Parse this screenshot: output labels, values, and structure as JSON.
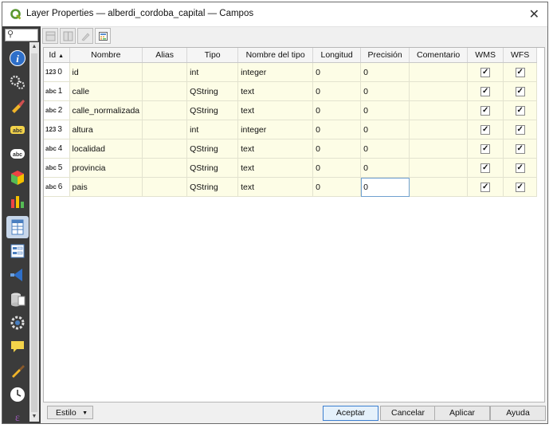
{
  "window": {
    "title": "Layer Properties — alberdi_cordoba_capital — Campos",
    "close_glyph": "✕"
  },
  "sidebar": {
    "search_placeholder": "",
    "items": [
      {
        "icon": "information-icon"
      },
      {
        "icon": "source-gears-icon"
      },
      {
        "icon": "symbology-brush-icon"
      },
      {
        "icon": "labels-icon"
      },
      {
        "icon": "mask-labels-icon"
      },
      {
        "icon": "3d-view-icon"
      },
      {
        "icon": "diagrams-icon"
      },
      {
        "icon": "source-fields-icon",
        "active": true
      },
      {
        "icon": "attributes-form-icon"
      },
      {
        "icon": "joins-icon"
      },
      {
        "icon": "auxiliary-storage-icon"
      },
      {
        "icon": "actions-icon"
      },
      {
        "icon": "display-tips-icon"
      },
      {
        "icon": "rendering-icon"
      },
      {
        "icon": "temporal-clock-icon"
      },
      {
        "icon": "variables-icon"
      }
    ]
  },
  "toolbar": {
    "buttons": [
      "new-field-icon",
      "delete-field-icon",
      "toggle-editing-icon",
      "field-calculator-icon"
    ]
  },
  "table": {
    "columns": [
      "Id",
      "Nombre",
      "Alias",
      "Tipo",
      "Nombre del tipo",
      "Longitud",
      "Precisión",
      "Comentario",
      "WMS",
      "WFS"
    ],
    "rows": [
      {
        "kind": "123",
        "id": "0",
        "nombre": "id",
        "alias": "",
        "tipo": "int",
        "nombre_tipo": "integer",
        "longitud": "0",
        "precision": "0",
        "comentario": "",
        "wms": "✓",
        "wfs": "✓"
      },
      {
        "kind": "abc",
        "id": "1",
        "nombre": "calle",
        "alias": "",
        "tipo": "QString",
        "nombre_tipo": "text",
        "longitud": "0",
        "precision": "0",
        "comentario": "",
        "wms": "✓",
        "wfs": "✓"
      },
      {
        "kind": "abc",
        "id": "2",
        "nombre": "calle_normalizada",
        "alias": "",
        "tipo": "QString",
        "nombre_tipo": "text",
        "longitud": "0",
        "precision": "0",
        "comentario": "",
        "wms": "✓",
        "wfs": "✓"
      },
      {
        "kind": "123",
        "id": "3",
        "nombre": "altura",
        "alias": "",
        "tipo": "int",
        "nombre_tipo": "integer",
        "longitud": "0",
        "precision": "0",
        "comentario": "",
        "wms": "✓",
        "wfs": "✓"
      },
      {
        "kind": "abc",
        "id": "4",
        "nombre": "localidad",
        "alias": "",
        "tipo": "QString",
        "nombre_tipo": "text",
        "longitud": "0",
        "precision": "0",
        "comentario": "",
        "wms": "✓",
        "wfs": "✓"
      },
      {
        "kind": "abc",
        "id": "5",
        "nombre": "provincia",
        "alias": "",
        "tipo": "QString",
        "nombre_tipo": "text",
        "longitud": "0",
        "precision": "0",
        "comentario": "",
        "wms": "✓",
        "wfs": "✓"
      },
      {
        "kind": "abc",
        "id": "6",
        "nombre": "pais",
        "alias": "",
        "tipo": "QString",
        "nombre_tipo": "text",
        "longitud": "0",
        "precision": "0",
        "comentario": "",
        "wms": "✓",
        "wfs": "✓"
      }
    ]
  },
  "bottom": {
    "style_label": "Estilo",
    "accept_label": "Aceptar",
    "cancel_label": "Cancelar",
    "apply_label": "Aplicar",
    "help_label": "Ayuda"
  }
}
